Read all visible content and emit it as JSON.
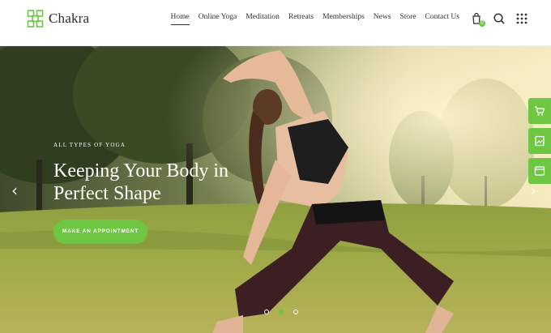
{
  "brand": {
    "name": "Chakra",
    "accent": "#6ec642"
  },
  "nav": {
    "items": [
      {
        "label": "Home",
        "active": true
      },
      {
        "label": "Online Yoga",
        "active": false
      },
      {
        "label": "Meditation",
        "active": false
      },
      {
        "label": "Retreats",
        "active": false
      },
      {
        "label": "Memberships",
        "active": false
      },
      {
        "label": "News",
        "active": false
      },
      {
        "label": "Store",
        "active": false
      },
      {
        "label": "Contact Us",
        "active": false
      }
    ]
  },
  "header_icons": [
    {
      "name": "cart-icon",
      "badge": "0"
    },
    {
      "name": "search-icon"
    },
    {
      "name": "grid-menu-icon"
    }
  ],
  "hero": {
    "eyebrow": "ALL TYPES OF YOGA",
    "headline": "Keeping Your Body in Perfect Shape",
    "cta_label": "MAKE AN APPOINTMENT",
    "prev_arrow": "‹",
    "next_arrow": "›",
    "slides": 3,
    "active_slide": 2
  },
  "side_tools": [
    "cart-icon",
    "image-icon",
    "browser-icon"
  ]
}
